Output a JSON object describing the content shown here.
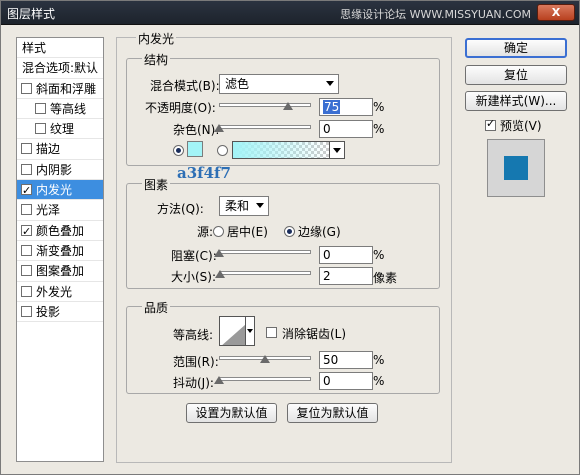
{
  "window": {
    "title": "图层样式",
    "watermark": "思缘设计论坛 WWW.MISSYUAN.COM",
    "close_label": "X"
  },
  "style_list": {
    "items": [
      {
        "label": "样式",
        "type": "header",
        "checked": false
      },
      {
        "label": "混合选项:默认",
        "type": "header",
        "checked": false
      },
      {
        "label": "斜面和浮雕",
        "type": "check",
        "checked": false
      },
      {
        "label": "等高线",
        "type": "sub",
        "checked": false
      },
      {
        "label": "纹理",
        "type": "sub",
        "checked": false
      },
      {
        "label": "描边",
        "type": "check",
        "checked": false
      },
      {
        "label": "内阴影",
        "type": "check",
        "checked": false
      },
      {
        "label": "内发光",
        "type": "check",
        "checked": true,
        "selected": true
      },
      {
        "label": "光泽",
        "type": "check",
        "checked": false
      },
      {
        "label": "颜色叠加",
        "type": "check",
        "checked": true
      },
      {
        "label": "渐变叠加",
        "type": "check",
        "checked": false
      },
      {
        "label": "图案叠加",
        "type": "check",
        "checked": false
      },
      {
        "label": "外发光",
        "type": "check",
        "checked": false
      },
      {
        "label": "投影",
        "type": "check",
        "checked": false
      }
    ]
  },
  "inner_glow": {
    "title": "内发光",
    "structure": {
      "title": "结构",
      "blend_mode_label": "混合模式(B):",
      "blend_mode_value": "滤色",
      "opacity_label": "不透明度(O):",
      "opacity_value": "75",
      "opacity_unit": "%",
      "opacity_fraction": 0.75,
      "noise_label": "杂色(N):",
      "noise_value": "0",
      "noise_unit": "%",
      "noise_fraction": 0.0,
      "color_hex": "#a3f4f7",
      "color_annotation": "a3f4f7"
    },
    "elements": {
      "title": "图素",
      "method_label": "方法(Q):",
      "method_value": "柔和",
      "source_label": "源:",
      "source_center": "居中(E)",
      "source_edge": "边缘(G)",
      "choke_label": "阻塞(C):",
      "choke_value": "0",
      "choke_unit": "%",
      "choke_fraction": 0.0,
      "size_label": "大小(S):",
      "size_value": "2",
      "size_unit": "像素",
      "size_fraction": 0.01
    },
    "quality": {
      "title": "品质",
      "contour_label": "等高线:",
      "antialias_label": "消除锯齿(L)",
      "range_label": "范围(R):",
      "range_value": "50",
      "range_unit": "%",
      "range_fraction": 0.5,
      "jitter_label": "抖动(J):",
      "jitter_value": "0",
      "jitter_unit": "%",
      "jitter_fraction": 0.0
    },
    "make_default_label": "设置为默认值",
    "reset_default_label": "复位为默认值"
  },
  "right_panel": {
    "ok_label": "确定",
    "reset_label": "复位",
    "new_style_label": "新建样式(W)...",
    "preview_label": "预览(V)",
    "preview_checked": true,
    "preview_color": "#1578b0"
  }
}
